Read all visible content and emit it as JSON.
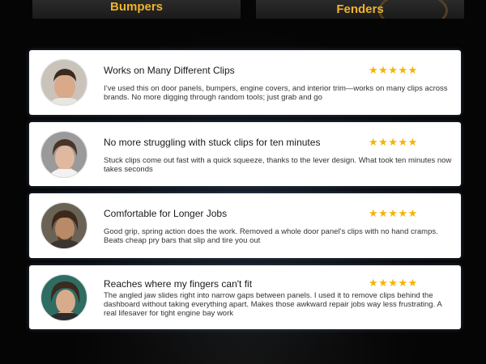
{
  "top_tiles": {
    "left_label": "Bumpers",
    "right_label": "Fenders"
  },
  "colors": {
    "background": "#050505",
    "accent_gold": "#f0b429",
    "star": "#f5b400",
    "card": "#ffffff"
  },
  "reviews": [
    {
      "title": "Works on Many Different Clips",
      "stars": "★★★★★",
      "rating": 5,
      "body": "I’ve used this on door panels, bumpers, engine covers, and interior trim—works on many clips across brands. No more digging through random tools; just grab and go"
    },
    {
      "title": "No more struggling with stuck clips for ten minutes",
      "stars": "★★★★★",
      "rating": 5,
      "body": "Stuck clips come out fast with a quick squeeze, thanks to the lever design. What took ten minutes now takes seconds"
    },
    {
      "title": "Comfortable for Longer Jobs",
      "stars": "★★★★★",
      "rating": 5,
      "body": "Good grip, spring action does the work. Removed a whole door panel’s clips with no hand cramps. Beats cheap pry bars that slip and tire you out"
    },
    {
      "title": "Reaches where my fingers can't fit",
      "stars": "★★★★★",
      "rating": 5,
      "body": "The angled jaw slides right into narrow gaps between panels. I used it to remove clips behind the dashboard without taking everything apart. Makes those awkward repair jobs way less frustrating. A real lifesaver for tight engine bay work"
    }
  ]
}
